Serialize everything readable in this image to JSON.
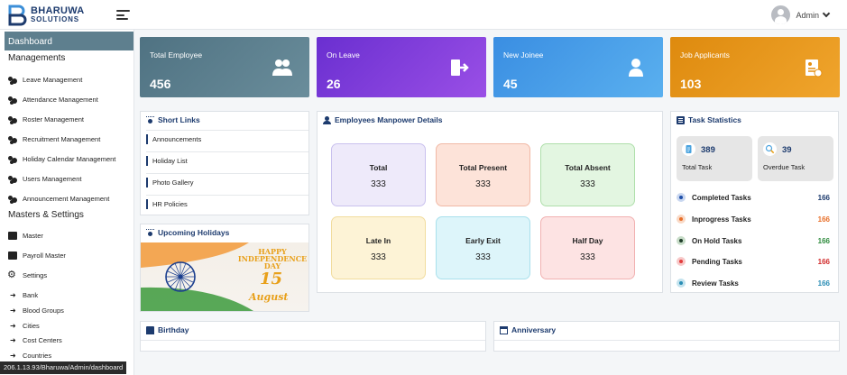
{
  "brand": {
    "line1": "BHARUWA",
    "line2": "SOLUTIONS"
  },
  "header": {
    "user_name": "Admin"
  },
  "sidebar": {
    "dashboard": "Dashboard",
    "managements_heading": "Managements",
    "management_items": [
      {
        "label": "Leave Management",
        "icon": "users-icon"
      },
      {
        "label": "Attendance Management",
        "icon": "users-icon"
      },
      {
        "label": "Roster Management",
        "icon": "users-icon"
      },
      {
        "label": "Recruitment Management",
        "icon": "users-icon"
      },
      {
        "label": "Holiday Calendar Management",
        "icon": "users-icon"
      },
      {
        "label": "Users Management",
        "icon": "users-icon"
      },
      {
        "label": "Announcement Management",
        "icon": "users-icon"
      }
    ],
    "masters_heading": "Masters & Settings",
    "master_items": [
      {
        "label": "Master",
        "icon": "folder-icon"
      },
      {
        "label": "Payroll Master",
        "icon": "folder-icon"
      },
      {
        "label": "Settings",
        "icon": "gear-icon"
      }
    ],
    "settings_sub_items": [
      "Bank",
      "Blood Groups",
      "Cities",
      "Cost Centers",
      "Countries"
    ],
    "status_url": "206.1.13.93/Bharuwa/Admin/dashboard"
  },
  "stats": [
    {
      "label": "Total Employee",
      "value": "456",
      "icon": "users-icon",
      "color": "#5a7d8d"
    },
    {
      "label": "On Leave",
      "value": "26",
      "icon": "exit-door-icon",
      "color": "#7d3bd6"
    },
    {
      "label": "New Joinee",
      "value": "45",
      "icon": "user-icon",
      "color": "#3c9be6"
    },
    {
      "label": "Job Applicants",
      "value": "103",
      "icon": "resume-icon",
      "color": "#e58f10"
    }
  ],
  "short_links": {
    "title": "Short Links",
    "items": [
      "Announcements",
      "Holiday List",
      "Photo Gallery",
      "HR Policies"
    ]
  },
  "upcoming_holidays": {
    "title": "Upcoming Holidays",
    "banner_line1": "HAPPY",
    "banner_line2": "INDEPENDENCE",
    "banner_line3": "DAY",
    "banner_day": "15",
    "banner_month": "August"
  },
  "manpower": {
    "title": "Employees Manpower Details",
    "boxes": [
      {
        "label": "Total",
        "value": "333",
        "bg": "#eeeafa",
        "border": "#c9c1ee"
      },
      {
        "label": "Total Present",
        "value": "333",
        "bg": "#fde3d9",
        "border": "#f1b9a6"
      },
      {
        "label": "Total Absent",
        "value": "333",
        "bg": "#e3f6e1",
        "border": "#afdfab"
      },
      {
        "label": "Late In",
        "value": "333",
        "bg": "#fdf3d6",
        "border": "#f1dc9e"
      },
      {
        "label": "Early Exit",
        "value": "333",
        "bg": "#ddf5fa",
        "border": "#a9e0ec"
      },
      {
        "label": "Half Day",
        "value": "333",
        "bg": "#fde3e3",
        "border": "#f1b1b1"
      }
    ]
  },
  "task_statistics": {
    "title": "Task Statistics",
    "cards": [
      {
        "label": "Total Task",
        "value": "389",
        "icon": "clipboard-icon"
      },
      {
        "label": "Overdue Task",
        "value": "39",
        "icon": "search-task-icon"
      }
    ],
    "rows": [
      {
        "label": "Completed Tasks",
        "count": "166",
        "dot": "#1f4fa8",
        "ring": "#c9d7f0",
        "count_color": "#1d3b6e"
      },
      {
        "label": "Inprogress Tasks",
        "count": "166",
        "dot": "#e8702a",
        "ring": "#f9d9c6",
        "count_color": "#e8702a"
      },
      {
        "label": "On Hold Tasks",
        "count": "166",
        "dot": "#1f3d2a",
        "ring": "#c7dcc8",
        "count_color": "#2e8b3d"
      },
      {
        "label": "Pending Tasks",
        "count": "166",
        "dot": "#e23d3d",
        "ring": "#f7c9c9",
        "count_color": "#d12b2b"
      },
      {
        "label": "Review Tasks",
        "count": "166",
        "dot": "#2a8db5",
        "ring": "#c4e3ee",
        "count_color": "#2a8db5"
      }
    ]
  },
  "birthday": {
    "title": "Birthday"
  },
  "anniversary": {
    "title": "Anniversary"
  }
}
